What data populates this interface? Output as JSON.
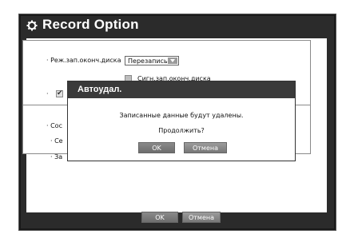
{
  "window": {
    "title": "Record Option"
  },
  "settings": {
    "disk_end_mode_label": "· Реж.зап.оконч.диска",
    "disk_end_mode_value": "Перезапись",
    "disk_end_signal_label": "Сигн.зап.оконч.диска",
    "bullet2": "·",
    "bullet3": "· Сос",
    "bullet4": "· Се",
    "bullet5": "· За"
  },
  "dialog": {
    "title": "Автоудал.",
    "message": "Записанные данные будут удалены.",
    "question": "Продолжить?",
    "ok_label": "OK",
    "cancel_label": "Отмена"
  },
  "footer": {
    "ok_label": "OK",
    "cancel_label": "Отмена"
  }
}
